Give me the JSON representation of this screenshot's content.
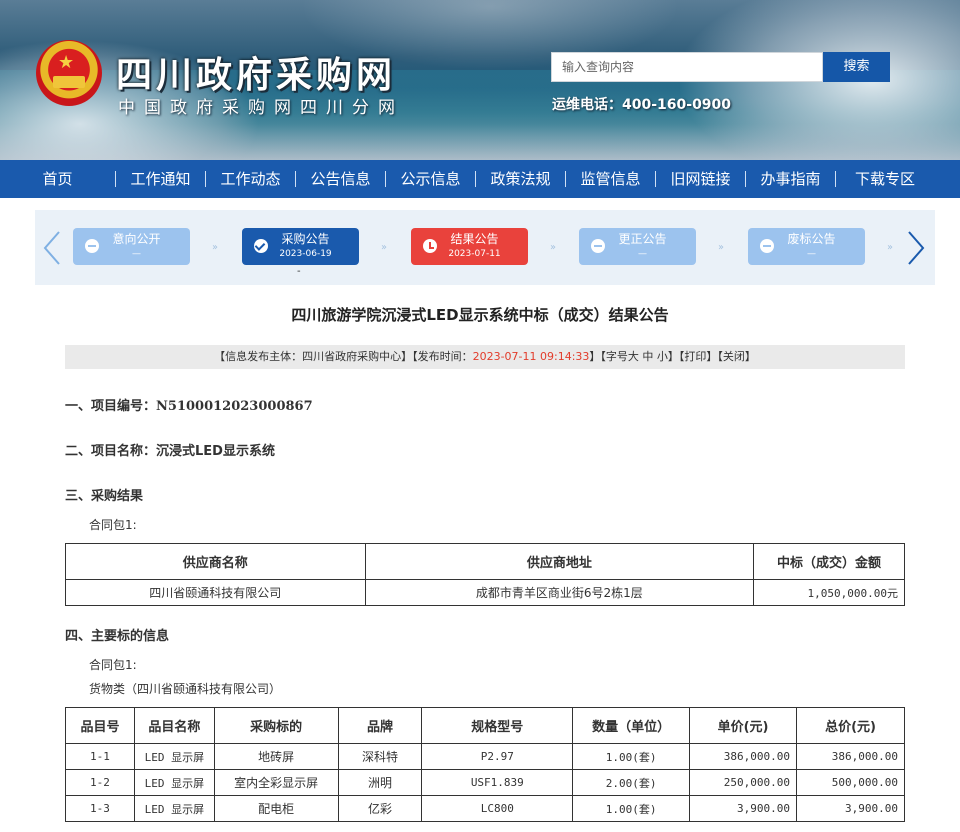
{
  "header": {
    "site_title": "四川政府采购网",
    "site_subtitle": "中国政府采购网四川分网",
    "search_placeholder": "输入查询内容",
    "search_button": "搜索",
    "hotline": "运维电话：400-160-0900"
  },
  "nav": [
    "首页",
    "工作通知",
    "工作动态",
    "公告信息",
    "公示信息",
    "政策法规",
    "监管信息",
    "旧网链接",
    "办事指南",
    "下载专区"
  ],
  "stepper": [
    {
      "label": "意向公开",
      "date": "—",
      "state": "pending"
    },
    {
      "label": "采购公告",
      "date": "2023-06-19",
      "state": "done"
    },
    {
      "label": "结果公告",
      "date": "2023-07-11",
      "state": "current"
    },
    {
      "label": "更正公告",
      "date": "—",
      "state": "pending"
    },
    {
      "label": "废标公告",
      "date": "—",
      "state": "pending"
    }
  ],
  "stepper_marker": "-",
  "colors": {
    "nav": "#1a5aad",
    "current_step": "#e9423c",
    "pending_step": "#9cc3ee",
    "time": "#e23c2b"
  },
  "article": {
    "title": "四川旅游学院沉浸式LED显示系统中标（成交）结果公告",
    "meta": {
      "publisher_prefix": "【信息发布主体：四川省政府采购中心】【发布时间：",
      "time": "2023-07-11 09:14:33",
      "suffix": "】【字号",
      "size_large": "大",
      "size_medium": "中",
      "size_small": "小",
      "mid": "】【",
      "print": "打印",
      "close": "关闭",
      "end": "】"
    },
    "s1_label": "一、项目编号：",
    "s1_value": "N5100012023000867",
    "s2_label": "二、项目名称：",
    "s2_value": "沉浸式LED显示系统",
    "s3_label": "三、采购结果",
    "s3_package": "合同包1:",
    "result_table": {
      "headers": [
        "供应商名称",
        "供应商地址",
        "中标（成交）金额"
      ],
      "row": [
        "四川省颐通科技有限公司",
        "成都市青羊区商业街6号2栋1层",
        "1,050,000.00元"
      ]
    },
    "s4_label": "四、主要标的信息",
    "s4_package": "合同包1:",
    "s4_category": "货物类（四川省颐通科技有限公司）",
    "items_table": {
      "headers": [
        "品目号",
        "品目名称",
        "采购标的",
        "品牌",
        "规格型号",
        "数量（单位）",
        "单价(元)",
        "总价(元)"
      ],
      "rows": [
        [
          "1-1",
          "LED 显示屏",
          "地砖屏",
          "深科特",
          "P2.97",
          "1.00(套)",
          "386,000.00",
          "386,000.00"
        ],
        [
          "1-2",
          "LED 显示屏",
          "室内全彩显示屏",
          "洲明",
          "USF1.839",
          "2.00(套)",
          "250,000.00",
          "500,000.00"
        ],
        [
          "1-3",
          "LED 显示屏",
          "配电柜",
          "亿彩",
          "LC800",
          "1.00(套)",
          "3,900.00",
          "3,900.00"
        ]
      ]
    }
  }
}
